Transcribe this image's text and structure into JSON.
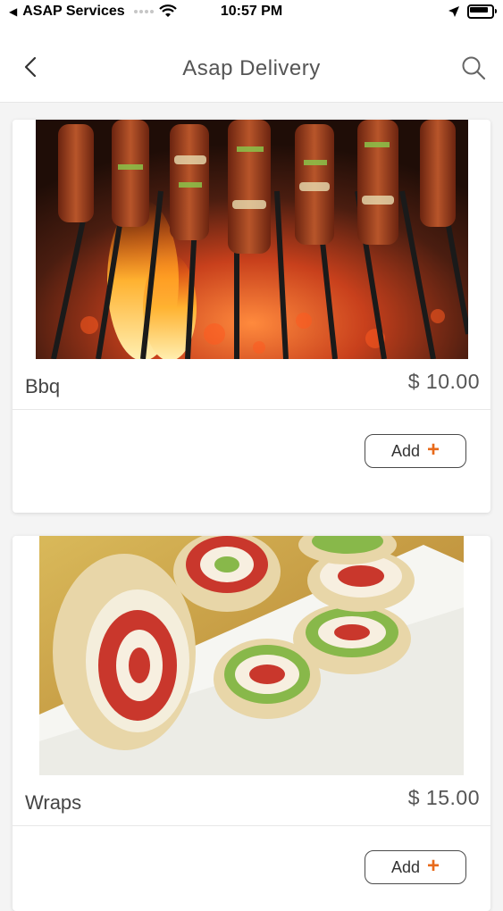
{
  "status_bar": {
    "carrier": "ASAP Services",
    "time": "10:57 PM"
  },
  "nav": {
    "title": "Asap Delivery",
    "back_icon": "chevron-left-icon",
    "search_icon": "search-icon"
  },
  "items": [
    {
      "name": "Bbq",
      "price": "$ 10.00",
      "add_label": "Add",
      "image": "bbq-skewers-photo"
    },
    {
      "name": "Wraps",
      "price": "$ 15.00",
      "add_label": "Add",
      "image": "wraps-photo"
    }
  ],
  "colors": {
    "accent": "#e86a1a",
    "background": "#f4f4f4",
    "card": "#ffffff"
  }
}
